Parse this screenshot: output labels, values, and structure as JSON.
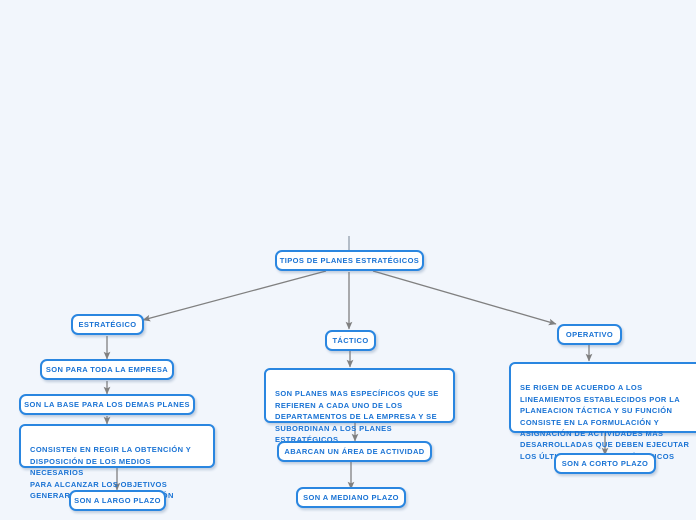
{
  "diagram": {
    "title": "TIPOS DE PLANES ESTRATÉGICOS",
    "background_color": "#f2f6fc",
    "node_fill_color": "#ffffff",
    "node_border_color": "#2a86e0",
    "node_text_color": "#1a73d4",
    "connector_color": "#808080",
    "root": {
      "label": "TIPOS DE PLANES ESTRATÉGICOS"
    },
    "branches": [
      {
        "key": "estrategico",
        "heading": "ESTRATÉGICO",
        "nodes": [
          {
            "key": "estrategico-1",
            "label": "SON PARA TODA LA EMPRESA"
          },
          {
            "key": "estrategico-2",
            "label": "SON LA BASE PARA LOS DEMAS PLANES"
          },
          {
            "key": "estrategico-3",
            "label": "CONSISTEN EN REGIR LA OBTENCIÓN Y\nDISPOSICIÓN DE LOS MEDIOS NECESARIOS\nPARA ALCANZAR LOS OBJETIVOS\nGENERARES DE LA ORGANIZACIÓN"
          },
          {
            "key": "estrategico-4",
            "label": "SON A LARGO PLAZO"
          }
        ]
      },
      {
        "key": "tactico",
        "heading": "TÁCTICO",
        "nodes": [
          {
            "key": "tactico-1",
            "label": "SON PLANES MAS ESPECÍFICOS QUE SE\nREFIEREN A CADA UNO DE LOS\nDEPARTAMENTOS DE LA EMPRESA Y SE\nSUBORDINAN A LOS PLANES\nESTRATÉGICOS"
          },
          {
            "key": "tactico-2",
            "label": "ABARCAN UN ÁREA DE ACTIVIDAD"
          },
          {
            "key": "tactico-3",
            "label": "SON A MEDIANO PLAZO"
          }
        ]
      },
      {
        "key": "operativo",
        "heading": "OPERATIVO",
        "nodes": [
          {
            "key": "operativo-1",
            "label": "SE RIGEN DE ACUERDO A LOS\nLINEAMIENTOS ESTABLECIDOS POR LA\nPLANEACION TÁCTICA Y SU FUNCIÓN\nCONSISTE EN LA FORMULACIÓN Y\nASIGNACIÓN DE ACTIVIDADES MAS\nDESARROLLADAS QUE DEBEN EJECUTAR\nLOS ÚLTIMOS NIVELES JERÁRQUICOS"
          },
          {
            "key": "operativo-2",
            "label": "SON A CORTO PLAZO"
          }
        ]
      }
    ]
  }
}
